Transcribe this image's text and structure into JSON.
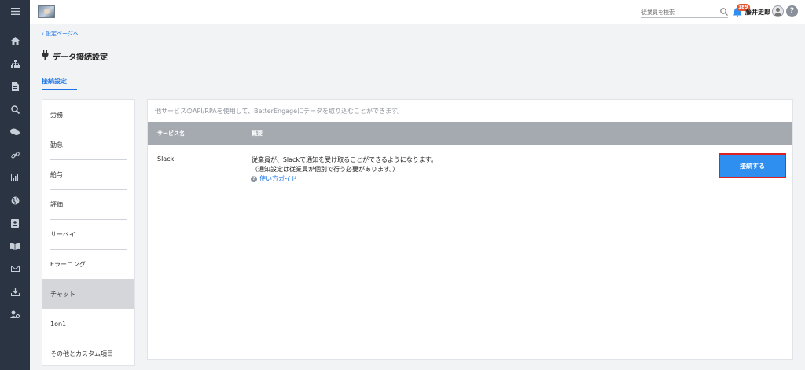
{
  "header": {
    "search_placeholder": "従業員を検索",
    "notification_count": "189",
    "user_name": "藤井史郎",
    "help_label": "?"
  },
  "sidebar_icons": [
    "menu-icon",
    "home-icon",
    "org-chart-icon",
    "document-icon",
    "search-icon",
    "chat-icon",
    "link-icon",
    "chart-icon",
    "globe-icon",
    "contact-card-icon",
    "book-icon",
    "mail-icon",
    "download-icon",
    "user-settings-icon"
  ],
  "breadcrumb": {
    "back_label": "設定ページへ"
  },
  "page": {
    "title": "データ接続設定"
  },
  "tabs": [
    {
      "label": "接続設定"
    }
  ],
  "side_menu": {
    "items": [
      {
        "label": "労務"
      },
      {
        "label": "勤怠"
      },
      {
        "label": "給与"
      },
      {
        "label": "評価"
      },
      {
        "label": "サーベイ"
      },
      {
        "label": "Eラーニング"
      },
      {
        "label": "チャット"
      },
      {
        "label": "1on1"
      },
      {
        "label": "その他とカスタム項目"
      }
    ],
    "active_index": 6
  },
  "panel": {
    "description": "他サービスのAPI/RPAを使用して、BetterEngageにデータを取り込むことができます。",
    "columns": [
      "サービス名",
      "概要"
    ],
    "rows": [
      {
        "service": "Slack",
        "summary_line1": "従業員が、Slackで通知を受け取ることができるようになります。",
        "summary_line2": "（通知設定は従業員が個別で行う必要があります。）",
        "guide_label": "使い方ガイド",
        "button_label": "接続する"
      }
    ]
  },
  "colors": {
    "accent": "#1a73e8",
    "rail": "#2b3442",
    "button": "#2f8ff0",
    "highlight_border": "#e0201f",
    "badge": "#e8542f"
  }
}
